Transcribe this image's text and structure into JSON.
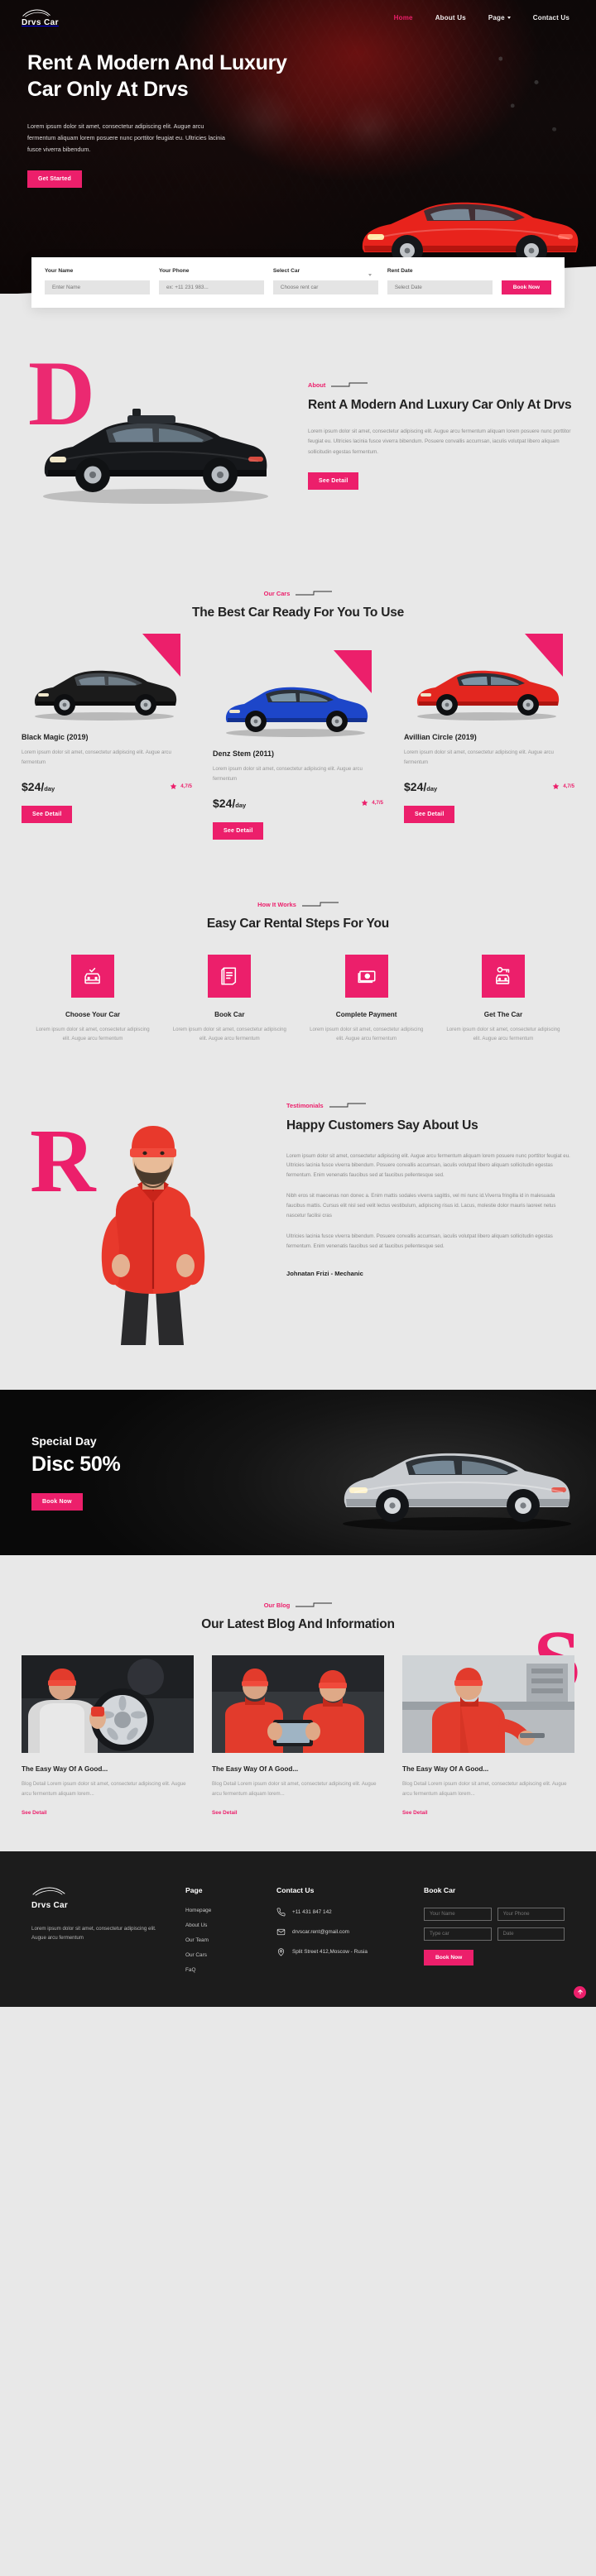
{
  "brand": {
    "name": "Drvs Car",
    "logo_icon": "car-silhouette-icon"
  },
  "nav": {
    "items": [
      {
        "label": "Home",
        "active": true
      },
      {
        "label": "About Us",
        "active": false
      },
      {
        "label": "Page",
        "active": false,
        "has_caret": true
      },
      {
        "label": "Contact Us",
        "active": false
      }
    ]
  },
  "hero": {
    "title": "Rent A Modern And Luxury Car Only At Drvs",
    "subtitle": "Lorem ipsum dolor sit amet, consectetur adipiscing elit. Augue arcu fermentum aliquam lorem posuere nunc porttitor feugiat eu. Ultricies lacinia fusce viverra bibendum.",
    "cta_label": "Get Started"
  },
  "booking": {
    "fields": [
      {
        "label": "Your Name",
        "placeholder": "Enter Name",
        "value": "",
        "type": "text",
        "name": "name"
      },
      {
        "label": "Your Phone",
        "placeholder": "ex: +11 231 983...",
        "value": "",
        "type": "text",
        "name": "phone"
      },
      {
        "label": "Select Car",
        "placeholder": "Choose rent car",
        "value": "",
        "type": "select",
        "name": "car"
      },
      {
        "label": "Rent Date",
        "placeholder": "Select Date",
        "value": "",
        "type": "text",
        "name": "date"
      }
    ],
    "submit_label": "Book Now"
  },
  "about": {
    "eyebrow": "About",
    "decor_letter": "D",
    "title": "Rent A Modern And Luxury Car Only At Drvs",
    "body": "Lorem ipsum dolor sit amet, consectetur adipiscing elit. Augue arcu fermentum aliquam lorem posuere nunc porttitor feugiat eu. Ultricies lacinia fusce viverra bibendum. Posuere convallis accumsan, iaculis volutpat libero aliquam sollicitudin egestas fermentum.",
    "cta_label": "See Detail"
  },
  "cars_section": {
    "eyebrow": "Our Cars",
    "title": "The Best Car Ready For You To Use",
    "cards": [
      {
        "name": "Black Magic (2019)",
        "desc": "Lorem ipsum dolor sit amet, consectetur adipiscing elit. Augue arcu fermentum",
        "price": "$24/",
        "price_unit": "day",
        "rating": "4,7/5",
        "cta_label": "See Detail",
        "color": "#1b1b1b"
      },
      {
        "name": "Denz Stem (2011)",
        "desc": "Lorem ipsum dolor sit amet, consectetur adipiscing elit. Augue arcu fermentum",
        "price": "$24/",
        "price_unit": "day",
        "rating": "4,7/5",
        "cta_label": "See Detail",
        "color": "#1d46c9"
      },
      {
        "name": "Avillian Circle (2019)",
        "desc": "Lorem ipsum dolor sit amet, consectetur adipiscing elit. Augue arcu fermentum",
        "price": "$24/",
        "price_unit": "day",
        "rating": "4,7/5",
        "cta_label": "See Detail",
        "color": "#e3261f"
      }
    ]
  },
  "how_section": {
    "eyebrow": "How It Works",
    "title": "Easy Car Rental Steps For You",
    "steps": [
      {
        "icon": "car-check-icon",
        "name": "Choose Your Car",
        "desc": "Lorem ipsum dolor sit amet, consectetur adipiscing elit. Augue arcu fermentum"
      },
      {
        "icon": "receipt-icon",
        "name": "Book Car",
        "desc": "Lorem ipsum dolor sit amet, consectetur adipiscing elit. Augue arcu fermentum"
      },
      {
        "icon": "banknote-icon",
        "name": "Complete Payment",
        "desc": "Lorem ipsum dolor sit amet, consectetur adipiscing elit. Augue arcu fermentum"
      },
      {
        "icon": "car-key-icon",
        "name": "Get The Car",
        "desc": "Lorem ipsum dolor sit amet, consectetur adipiscing elit. Augue arcu fermentum"
      }
    ]
  },
  "testimonials": {
    "eyebrow": "Testimonials",
    "decor_letter": "R",
    "title": "Happy Customers Say About Us",
    "p1": "Lorem ipsum dolor sit amet, consectetur adipiscing elit. Augue arcu fermentum aliquam lorem posuere nunc porttitor feugiat eu. Ultricies lacinia fusce viverra bibendum. Posuere convallis accumsan, iaculis volutpat libero aliquam sollicitudin egestas fermentum. Enim venenatis faucibus sed at faucibus pellentesque sed.",
    "p2": "Nibh eros sit maecenas non donec a. Enim mattis sodales viverra sagittis, vel mi nunc id.Viverra fringilla id in malesuada faucibus mattis. Cursus elit nisl sed velit lectus vestibulum, adipiscing risus id. Lacus, molestie dolor mauris laoreet netus nascetur facilisi cras",
    "p3": "Ultricies lacinia fusce viverra bibendum. Posuere convallis accumsan, iaculis volutpat libero aliquam sollicitudin egestas fermentum. Enim venenatis faucibus sed at faucibus pellentesque sed.",
    "author": "Johnatan Frizi - Mechanic"
  },
  "special": {
    "small_title": "Special Day",
    "big_title": "Disc 50%",
    "cta_label": "Book Now"
  },
  "blog_section": {
    "eyebrow": "Our Blog",
    "decor_letter": "S",
    "title": "Our Latest Blog And Information",
    "posts": [
      {
        "title": "The Easy Way Of A Good...",
        "desc": "Blog Detail Lorem ipsum dolor sit amet, consectetur adipiscing elit. Augue arcu fermentum aliquam lorem...",
        "link_label": "See Detail",
        "image": "mechanic-holding-wheel"
      },
      {
        "title": "The Easy Way Of A Good...",
        "desc": "Blog Detail Lorem ipsum dolor sit amet, consectetur adipiscing elit. Augue arcu fermentum aliquam lorem...",
        "link_label": "See Detail",
        "image": "two-mechanics-tablet"
      },
      {
        "title": "The Easy Way Of A Good...",
        "desc": "Blog Detail Lorem ipsum dolor sit amet, consectetur adipiscing elit. Augue arcu fermentum aliquam lorem...",
        "link_label": "See Detail",
        "image": "mechanic-at-workbench"
      }
    ]
  },
  "footer": {
    "brand_name": "Drvs Car",
    "about": "Lorem ipsum dolor sit amet, consectetur adipiscing elit. Augue arcu fermentum",
    "page_heading": "Page",
    "page_links": [
      "Homepage",
      "About Us",
      "Our Team",
      "Our Cars",
      "FaQ"
    ],
    "contact_heading": "Contact Us",
    "contact": [
      {
        "icon": "phone-icon",
        "text": "+11 431 847 142"
      },
      {
        "icon": "envelope-icon",
        "text": "drvscar.rent@gmail.com"
      },
      {
        "icon": "map-pin-icon",
        "text": "Split Street 412,Moscow - Rusia"
      }
    ],
    "book_heading": "Book Car",
    "book_fields": [
      {
        "placeholder": "Your Name",
        "value": ""
      },
      {
        "placeholder": "Your Phone",
        "value": ""
      },
      {
        "placeholder": "Type car",
        "value": ""
      },
      {
        "placeholder": "Date",
        "value": ""
      }
    ],
    "book_cta": "Book Now"
  },
  "colors": {
    "accent": "#ec1f6b",
    "dark": "#1c1c1c",
    "page_bg": "#e8e8e8"
  }
}
